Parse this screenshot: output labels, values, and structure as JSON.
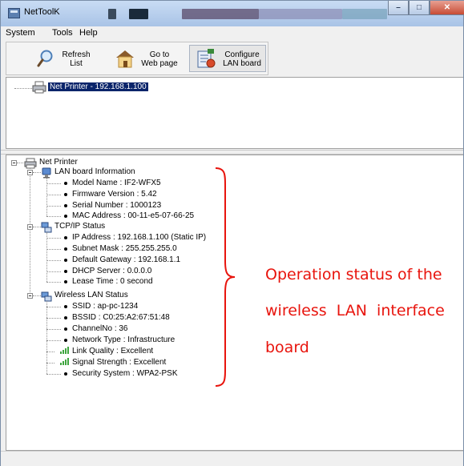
{
  "window": {
    "title": "NetToolK"
  },
  "menu": {
    "items": [
      "System",
      "Tools",
      "Help"
    ]
  },
  "toolbar": {
    "refresh": {
      "line1": "Refresh",
      "line2": "List"
    },
    "goto": {
      "line1": "Go to",
      "line2": "Web page"
    },
    "configure": {
      "line1": "Configure",
      "line2": "LAN board"
    }
  },
  "device_list": {
    "selected": "Net Printer - 192.168.1.100"
  },
  "tree": {
    "root": "Net Printer",
    "lan_board": {
      "title": "LAN board Information",
      "items": [
        "Model Name : IF2-WFX5",
        "Firmware Version : 5.42",
        "Serial Number : 1000123",
        "MAC Address : 00-11-e5-07-66-25"
      ]
    },
    "tcpip": {
      "title": "TCP/IP Status",
      "items": [
        "IP Address : 192.168.1.100 (Static IP)",
        "Subnet Mask : 255.255.255.0",
        "Default Gateway : 192.168.1.1",
        "DHCP Server : 0.0.0.0",
        "Lease Time : 0 second"
      ]
    },
    "wireless": {
      "title": "Wireless LAN Status",
      "items": [
        "SSID : ap-pc-1234",
        "BSSID : C0:25:A2:67:51:48",
        "ChannelNo : 36",
        "Network Type : Infrastructure",
        "Link Quality : Excellent",
        "Signal Strength : Excellent",
        "Security System : WPA2-PSK"
      ]
    }
  },
  "annotation": {
    "line1": "Operation status of the",
    "line2": "wireless  LAN  interface",
    "line3": "board",
    "color": "#e8140d"
  }
}
